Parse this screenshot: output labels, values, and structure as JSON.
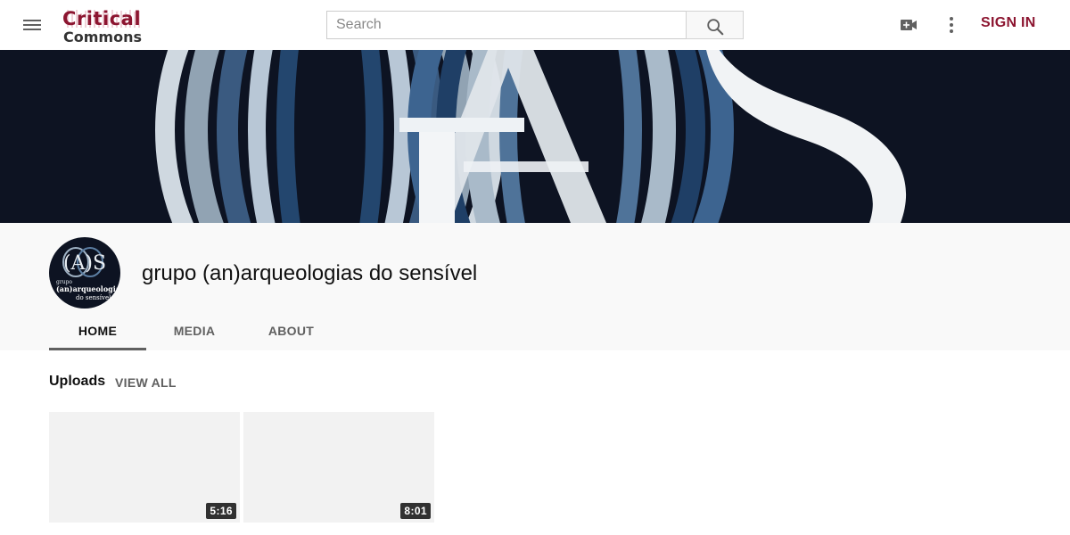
{
  "topbar": {
    "logo_line1": "Critical",
    "logo_line2": "Commons",
    "search_placeholder": "Search",
    "signin_label": "SIGN IN",
    "icons": [
      "menu-icon",
      "search-icon",
      "video-create-icon",
      "more-vert-icon"
    ]
  },
  "channel": {
    "name": "grupo (an)arqueologias do sensível",
    "avatar_text_line1": "grupo",
    "avatar_text_line2": "(an)arqueologias",
    "avatar_text_line3": "do sensível",
    "tabs": [
      {
        "label": "HOME",
        "active": true
      },
      {
        "label": "MEDIA",
        "active": false
      },
      {
        "label": "ABOUT",
        "active": false
      }
    ]
  },
  "uploads": {
    "title": "Uploads",
    "view_all": "VIEW ALL",
    "videos": [
      {
        "duration": "5:16"
      },
      {
        "duration": "8:01"
      }
    ]
  },
  "colors": {
    "brand": "#8c1530",
    "banner_bg": "#0d1322",
    "header_bg": "#f9f9f9"
  }
}
